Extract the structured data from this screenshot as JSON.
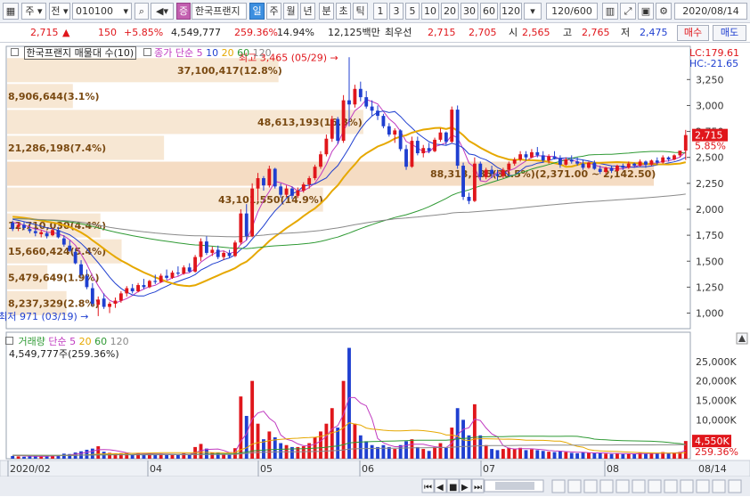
{
  "toolbar": {
    "market": "주",
    "type": "전",
    "code": "010100",
    "stock_badge": "증",
    "stock_name": "한국프랜지",
    "periods": [
      "일",
      "주",
      "월",
      "년",
      "분",
      "초",
      "틱"
    ],
    "active_period": "일",
    "intervals": [
      "1",
      "3",
      "5",
      "10",
      "20",
      "30",
      "60",
      "120"
    ],
    "count": "120/600",
    "date": "2020/08/14"
  },
  "quote": {
    "price": "2,715",
    "arrow": "▲",
    "change": "150",
    "change_pct": "+5.85%",
    "volume": "4,549,777",
    "volume_pct": "259.36%",
    "turnover": "14.94%",
    "amount": "12,125백만",
    "best_bid_label": "최우선",
    "best_ask": "2,715",
    "best_bid": "2,705",
    "open_label": "시",
    "open": "2,565",
    "high_label": "고",
    "high": "2,765",
    "low_label": "저",
    "low": "2,475",
    "buy_label": "매수",
    "sell_label": "매도"
  },
  "price_panel": {
    "title": "한국프랜지 매물대 수(10)",
    "ma_label": "종가 단순",
    "ma_periods": [
      "5",
      "10",
      "20",
      "60",
      "120"
    ],
    "ma_colors": [
      "#c03ac0",
      "#1f3fd0",
      "#e6a800",
      "#2f9a34",
      "#8a8a8a"
    ],
    "lc": "LC:179.61",
    "hc": "HC:-21.65",
    "high_marker": "최고 3,465 (05/29)",
    "low_marker": "최저 971 (03/19)",
    "last_price_tag": "2,715",
    "last_pct_tag": "5.85%",
    "volume_profile": [
      {
        "label": "37,100,417(12.8%)"
      },
      {
        "label": "8,906,644(3.1%)"
      },
      {
        "label": "48,613,193(16.8%)"
      },
      {
        "label": "21,286,198(7.4%)"
      },
      {
        "label": "88,313,185(30.5%)(2,371.00 ~ 2,142.50)"
      },
      {
        "label": "43,101,550(14.9%)"
      },
      {
        "label": "12,710,030(4.4%)"
      },
      {
        "label": "15,660,424(5.4%)"
      },
      {
        "label": "5,479,649(1.9%)"
      },
      {
        "label": "8,237,329(2.8%)"
      }
    ]
  },
  "volume_panel": {
    "title": "거래량",
    "ma_label": "단순",
    "ma_periods": [
      "5",
      "20",
      "60",
      "120"
    ],
    "ma_colors": [
      "#c03ac0",
      "#e6a800",
      "#2f9a34",
      "#8a8a8a"
    ],
    "value": "4,549,777주(259.36%)",
    "last_volume_tag": "4,550K",
    "last_pct_tag": "259.36%"
  },
  "chart_data": {
    "type": "candlestick",
    "price_axis": {
      "min": 850,
      "max": 3450,
      "ticks": [
        "3,250",
        "3,000",
        "2,750",
        "2,500",
        "2,250",
        "2,000",
        "1,750",
        "1,500",
        "1,250",
        "1,000"
      ]
    },
    "volume_axis": {
      "min": 0,
      "max": 30000,
      "ticks": [
        "25,000K",
        "20,000K",
        "15,000K",
        "10,000K",
        "5,000K"
      ]
    },
    "x_ticks": [
      "2020/02",
      "04",
      "05",
      "06",
      "07",
      "08",
      "08/14"
    ],
    "profile_range": [
      2142.5,
      2371.0
    ],
    "candles": [
      [
        1870,
        1890,
        1790,
        1810,
        700
      ],
      [
        1830,
        1870,
        1790,
        1850,
        600
      ],
      [
        1850,
        1880,
        1800,
        1820,
        500
      ],
      [
        1810,
        1840,
        1770,
        1790,
        600
      ],
      [
        1790,
        1820,
        1740,
        1770,
        700
      ],
      [
        1760,
        1800,
        1730,
        1780,
        600
      ],
      [
        1770,
        1790,
        1720,
        1740,
        700
      ],
      [
        1750,
        1820,
        1740,
        1800,
        900
      ],
      [
        1800,
        1830,
        1720,
        1730,
        800
      ],
      [
        1720,
        1750,
        1640,
        1660,
        1300
      ],
      [
        1650,
        1700,
        1590,
        1600,
        1200
      ],
      [
        1590,
        1620,
        1470,
        1480,
        1600
      ],
      [
        1470,
        1510,
        1350,
        1370,
        1900
      ],
      [
        1360,
        1420,
        1230,
        1250,
        2300
      ],
      [
        1240,
        1290,
        1070,
        1090,
        2600
      ],
      [
        1080,
        1160,
        971,
        1130,
        3200
      ],
      [
        1140,
        1190,
        1040,
        1060,
        1800
      ],
      [
        1060,
        1110,
        1000,
        1090,
        1500
      ],
      [
        1090,
        1150,
        1050,
        1120,
        1300
      ],
      [
        1120,
        1210,
        1100,
        1190,
        1400
      ],
      [
        1190,
        1260,
        1160,
        1240,
        1500
      ],
      [
        1240,
        1280,
        1190,
        1210,
        1100
      ],
      [
        1210,
        1290,
        1200,
        1270,
        1300
      ],
      [
        1270,
        1330,
        1230,
        1250,
        1200
      ],
      [
        1250,
        1320,
        1240,
        1310,
        1200
      ],
      [
        1310,
        1370,
        1280,
        1300,
        1100
      ],
      [
        1300,
        1380,
        1290,
        1360,
        1300
      ],
      [
        1360,
        1420,
        1320,
        1340,
        1000
      ],
      [
        1340,
        1410,
        1330,
        1390,
        1100
      ],
      [
        1390,
        1450,
        1360,
        1380,
        1000
      ],
      [
        1380,
        1460,
        1370,
        1440,
        1400
      ],
      [
        1440,
        1480,
        1390,
        1400,
        1100
      ],
      [
        1400,
        1560,
        1390,
        1540,
        3000
      ],
      [
        1540,
        1720,
        1500,
        1690,
        3800
      ],
      [
        1690,
        1740,
        1560,
        1580,
        2600
      ],
      [
        1580,
        1640,
        1550,
        1610,
        1600
      ],
      [
        1610,
        1650,
        1520,
        1540,
        1500
      ],
      [
        1540,
        1600,
        1510,
        1580,
        1200
      ],
      [
        1580,
        1610,
        1530,
        1550,
        1000
      ],
      [
        1550,
        1700,
        1540,
        1680,
        2700
      ],
      [
        1680,
        2000,
        1660,
        1960,
        16000
      ],
      [
        1960,
        2050,
        1700,
        1740,
        11000
      ],
      [
        1740,
        2250,
        1730,
        2200,
        20000
      ],
      [
        2200,
        2350,
        2080,
        2300,
        9000
      ],
      [
        2300,
        2320,
        2180,
        2230,
        5000
      ],
      [
        2230,
        2420,
        2210,
        2390,
        7000
      ],
      [
        2390,
        2400,
        2200,
        2220,
        5500
      ],
      [
        2220,
        2250,
        2110,
        2140,
        4000
      ],
      [
        2140,
        2230,
        2120,
        2200,
        3500
      ],
      [
        2200,
        2220,
        2100,
        2130,
        3000
      ],
      [
        2130,
        2210,
        2110,
        2180,
        3000
      ],
      [
        2180,
        2260,
        2160,
        2240,
        3200
      ],
      [
        2240,
        2320,
        2200,
        2300,
        4000
      ],
      [
        2300,
        2430,
        2280,
        2410,
        5500
      ],
      [
        2410,
        2560,
        2390,
        2530,
        7000
      ],
      [
        2530,
        2720,
        2510,
        2680,
        9000
      ],
      [
        2680,
        2900,
        2650,
        2870,
        13000
      ],
      [
        2870,
        2890,
        2630,
        2660,
        8000
      ],
      [
        2660,
        3100,
        2640,
        3050,
        20000
      ],
      [
        3050,
        3465,
        2800,
        3010,
        28500
      ],
      [
        3010,
        3200,
        2980,
        3160,
        9000
      ],
      [
        3160,
        3230,
        3040,
        3080,
        6000
      ],
      [
        3080,
        3140,
        2970,
        2990,
        4500
      ],
      [
        2990,
        3050,
        2900,
        2950,
        3500
      ],
      [
        2950,
        3000,
        2860,
        2900,
        3000
      ],
      [
        2900,
        2920,
        2780,
        2800,
        3500
      ],
      [
        2800,
        2830,
        2700,
        2720,
        3000
      ],
      [
        2720,
        2780,
        2640,
        2760,
        2500
      ],
      [
        2760,
        2770,
        2560,
        2580,
        3500
      ],
      [
        2580,
        2620,
        2380,
        2410,
        4500
      ],
      [
        2410,
        2700,
        2400,
        2660,
        5000
      ],
      [
        2660,
        2700,
        2520,
        2540,
        3000
      ],
      [
        2540,
        2620,
        2500,
        2590,
        2500
      ],
      [
        2590,
        2640,
        2540,
        2560,
        2000
      ],
      [
        2560,
        2690,
        2550,
        2670,
        3000
      ],
      [
        2670,
        2780,
        2650,
        2740,
        4000
      ],
      [
        2740,
        2750,
        2620,
        2650,
        2800
      ],
      [
        2650,
        2990,
        2640,
        2960,
        8000
      ],
      [
        2960,
        3000,
        2390,
        2420,
        13000
      ],
      [
        2420,
        2450,
        2090,
        2120,
        10000
      ],
      [
        2120,
        2160,
        2050,
        2080,
        6000
      ],
      [
        2080,
        2500,
        2070,
        2440,
        14000
      ],
      [
        2440,
        2460,
        2280,
        2310,
        6000
      ],
      [
        2310,
        2400,
        2290,
        2380,
        3500
      ],
      [
        2380,
        2420,
        2300,
        2340,
        2500
      ],
      [
        2340,
        2380,
        2280,
        2320,
        2200
      ],
      [
        2320,
        2400,
        2300,
        2380,
        2500
      ],
      [
        2380,
        2460,
        2350,
        2440,
        2800
      ],
      [
        2440,
        2500,
        2420,
        2480,
        2500
      ],
      [
        2480,
        2560,
        2460,
        2530,
        2800
      ],
      [
        2530,
        2560,
        2470,
        2500,
        2200
      ],
      [
        2500,
        2580,
        2490,
        2550,
        2400
      ],
      [
        2550,
        2600,
        2500,
        2520,
        2200
      ],
      [
        2520,
        2560,
        2450,
        2470,
        2000
      ],
      [
        2470,
        2530,
        2440,
        2510,
        1800
      ],
      [
        2510,
        2560,
        2480,
        2490,
        1700
      ],
      [
        2490,
        2520,
        2400,
        2430,
        2000
      ],
      [
        2430,
        2500,
        2420,
        2480,
        1700
      ],
      [
        2480,
        2520,
        2440,
        2460,
        1500
      ],
      [
        2460,
        2500,
        2420,
        2440,
        1400
      ],
      [
        2440,
        2480,
        2380,
        2400,
        1600
      ],
      [
        2400,
        2460,
        2390,
        2450,
        1500
      ],
      [
        2450,
        2470,
        2380,
        2390,
        1400
      ],
      [
        2390,
        2420,
        2340,
        2360,
        1500
      ],
      [
        2360,
        2410,
        2340,
        2400,
        1300
      ],
      [
        2400,
        2420,
        2350,
        2370,
        1200
      ],
      [
        2370,
        2430,
        2360,
        2420,
        1400
      ],
      [
        2420,
        2440,
        2380,
        2400,
        1200
      ],
      [
        2400,
        2460,
        2390,
        2440,
        1300
      ],
      [
        2440,
        2450,
        2400,
        2420,
        1200
      ],
      [
        2420,
        2480,
        2410,
        2460,
        1500
      ],
      [
        2460,
        2470,
        2400,
        2430,
        1300
      ],
      [
        2430,
        2480,
        2420,
        2470,
        1400
      ],
      [
        2470,
        2500,
        2430,
        2450,
        1300
      ],
      [
        2450,
        2520,
        2440,
        2500,
        1700
      ],
      [
        2500,
        2510,
        2460,
        2480,
        1400
      ],
      [
        2480,
        2530,
        2470,
        2520,
        1600
      ],
      [
        2520,
        2540,
        2500,
        2565,
        1754
      ],
      [
        2565,
        2765,
        2475,
        2715,
        4550
      ]
    ]
  }
}
